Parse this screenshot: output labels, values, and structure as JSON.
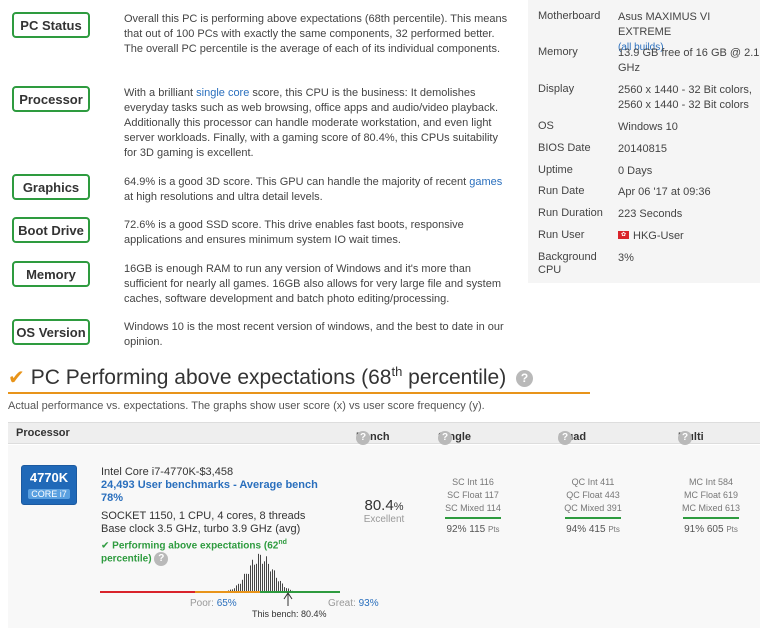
{
  "summary": [
    {
      "tag": "PC Status",
      "text": "Overall this PC is performing above expectations (68th percentile). This means that out of 100 PCs with exactly the same components, 32 performed better. The overall PC percentile is the average of each of its individual components."
    },
    {
      "tag": "Processor",
      "pre": "With a brilliant ",
      "link": "single core",
      "post": " score, this CPU is the business: It demolishes everyday tasks such as web browsing, office apps and audio/video playback. Additionally this processor can handle moderate workstation, and even light server workloads. Finally, with a gaming score of 80.4%, this CPUs suitability for 3D gaming is excellent."
    },
    {
      "tag": "Graphics",
      "pre": "64.9% is a good 3D score. This GPU can handle the majority of recent ",
      "link": "games",
      "post": " at high resolutions and ultra detail levels."
    },
    {
      "tag": "Boot Drive",
      "text": "72.6% is a good SSD score. This drive enables fast boots, responsive applications and ensures minimum system IO wait times."
    },
    {
      "tag": "Memory",
      "text": "16GB is enough RAM to run any version of Windows and it's more than sufficient for nearly all games. 16GB also allows for very large file and system caches, software development and batch photo editing/processing."
    },
    {
      "tag": "OS Version",
      "text": "Windows 10 is the most recent version of windows, and the best to date in our opinion."
    }
  ],
  "specs": [
    {
      "k": "Motherboard",
      "v": "Asus MAXIMUS VI EXTREME",
      "sub": "(all builds)"
    },
    {
      "k": "Memory",
      "v": "13.9 GB free of 16 GB @ 2.1 GHz"
    },
    {
      "k": "Display",
      "v": "2560 x 1440 - 32 Bit colors, 2560 x 1440 - 32 Bit colors"
    },
    {
      "k": "OS",
      "v": "Windows 10"
    },
    {
      "k": "BIOS Date",
      "v": "20140815"
    },
    {
      "k": "Uptime",
      "v": "0 Days"
    },
    {
      "k": "Run Date",
      "v": "Apr 06 '17 at 09:36"
    },
    {
      "k": "Run Duration",
      "v": "223 Seconds"
    },
    {
      "k": "Run User",
      "v": "HKG-User"
    },
    {
      "k": "Background CPU",
      "v": "3%"
    }
  ],
  "performance": {
    "title_pre": "PC Performing above expectations (68",
    "title_sup": "th",
    "title_post": " percentile)",
    "help": "?",
    "subtitle": "Actual performance vs. expectations. The graphs show user score (x) vs user score frequency (y)."
  },
  "table": {
    "headers": {
      "processor": "Processor",
      "bench": "Bench",
      "single": "Single core",
      "quad": "Quad core",
      "multi": "Multi core"
    },
    "cpu": {
      "logo_model": "4770K",
      "logo_brand": "CORE i7",
      "name": "Intel Core i7-4770K-$3,458",
      "benchmarks": "24,493 User benchmarks - Average bench 78%",
      "line1": "SOCKET 1150, 1 CPU, 4 cores, 8 threads",
      "line2": "Base clock 3.5 GHz, turbo 3.9 GHz (avg)",
      "perf_pre": "✔ Performing above expectations (62",
      "perf_sup": "nd",
      "perf_post": "percentile)",
      "bench_value": "80.4",
      "bench_unit": "%",
      "bench_label": "Excellent",
      "single": {
        "l1": "SC Int 116",
        "l2": "SC Float 117",
        "l3": "SC Mixed 114",
        "pct": "92% 115",
        "unit": "Pts"
      },
      "quad": {
        "l1": "QC Int 411",
        "l2": "QC Float 443",
        "l3": "QC Mixed 391",
        "pct": "94% 415",
        "unit": "Pts"
      },
      "multi": {
        "l1": "MC Int 584",
        "l2": "MC Float 619",
        "l3": "MC Mixed 613",
        "pct": "91% 605",
        "unit": "Pts"
      },
      "poor_label": "Poor:",
      "poor_value": "65%",
      "great_label": "Great:",
      "great_value": "93%",
      "this_bench": "This bench: 80.4%"
    }
  },
  "colors": {
    "accent_green": "#2e9b3f",
    "accent_orange": "#e8941a",
    "link_blue": "#2a6fbd",
    "flag_red": "#d9242b"
  }
}
